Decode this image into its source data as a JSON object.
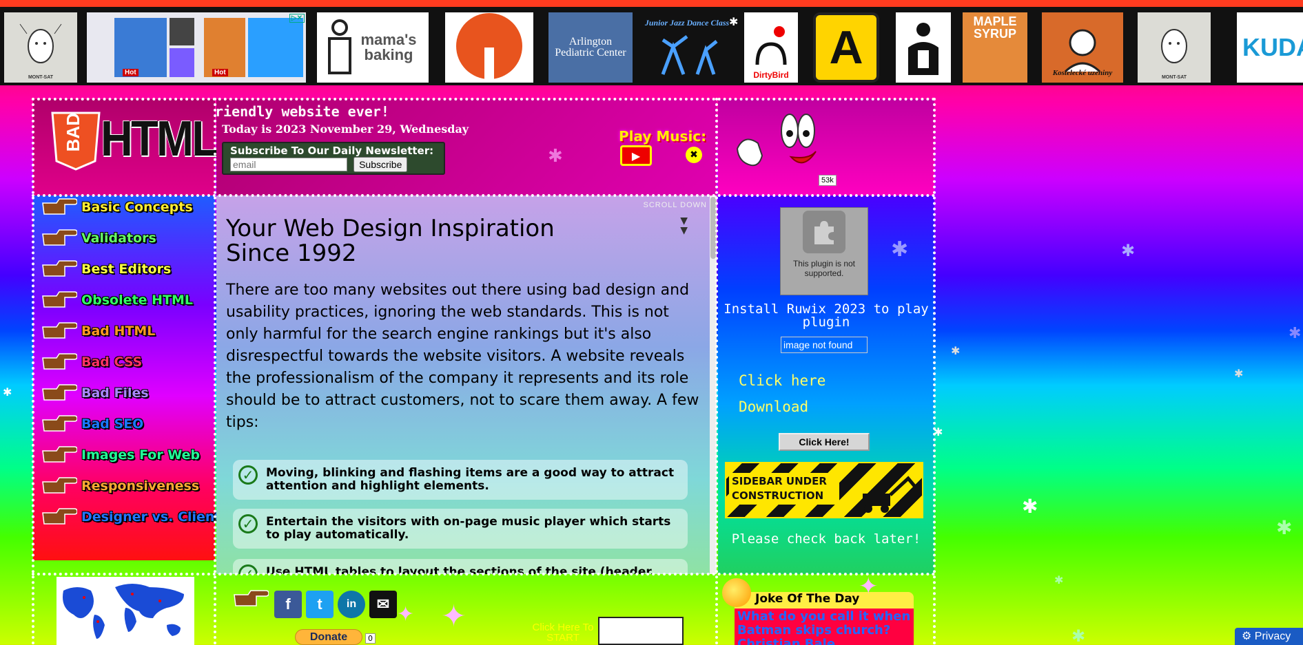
{
  "topbar": {
    "ads": [
      {
        "text": "MONT-SAT"
      },
      {
        "text": "Hot"
      },
      {
        "text": "Hot"
      },
      {
        "text": "mama's baking"
      },
      {
        "text": ""
      },
      {
        "text": "Arlington Pediatric Center"
      },
      {
        "text": "Junior Jazz Dance Class"
      },
      {
        "text": "DirtyBird"
      },
      {
        "text": "A"
      },
      {
        "text": ""
      },
      {
        "text": "MAPLE SYRUP"
      },
      {
        "text": "Kostelecké uzeniny"
      },
      {
        "text": "MONT-SAT"
      },
      {
        "text": "KUDA"
      }
    ]
  },
  "header": {
    "logo_bad": "BAD",
    "logo_html": "HTML",
    "marquee": "riendly website ever!",
    "date": "Today is 2023 November 29, Wednesday",
    "newsletter": {
      "label": "Subscribe To Our Daily Newsletter:",
      "placeholder": "email",
      "button": "Subscribe"
    },
    "music_label": "Play Music:",
    "counter": "53k"
  },
  "nav": {
    "items": [
      {
        "label": "Basic Concepts",
        "color": "#ffee33"
      },
      {
        "label": "Validators",
        "color": "#66ff66"
      },
      {
        "label": "Best Editors",
        "color": "#ffff44"
      },
      {
        "label": "Obsolete HTML",
        "color": "#33ff66"
      },
      {
        "label": "Bad HTML",
        "color": "#ff9922"
      },
      {
        "label": "Bad CSS",
        "color": "#ff3366"
      },
      {
        "label": "Bad Files",
        "color": "#aa88ff"
      },
      {
        "label": "Bad SEO",
        "color": "#1a7aff"
      },
      {
        "label": "Images For Web",
        "color": "#22ff99"
      },
      {
        "label": "Responsiveness",
        "color": "#ffaa33"
      },
      {
        "label": "Designer vs. Client",
        "color": "#2277ff"
      }
    ]
  },
  "main": {
    "scroll_down": "SCROLL DOWN",
    "title_line1": "Your Web Design Inspiration",
    "title_line2": "Since 1992",
    "intro": "There are too many websites out there using bad design and usability practices, ignoring the web standards. This is not only harmful for the search engine rankings but it's also disrespectful towards the website visitors. A website reveals the professionalism of the company it represents and its role should be to attract customers, not to scare them away. A few tips:",
    "tips": [
      "Moving, blinking and flashing items are a good way to attract attention and highlight elements.",
      "Entertain the visitors with on-page music player which starts to play automatically.",
      "Use HTML tables to layout the sections of the site (header,"
    ]
  },
  "sidebar": {
    "plugin_text": "This plugin is not supported.",
    "install_text": "Install Ruwix 2023 to play plugin",
    "broken_image": "image not found",
    "link_click": "Click here",
    "link_download": "Download",
    "click_button": "Click Here!",
    "construction": "SIDEBAR UNDER CONSTRUCTION",
    "check_back": "Please check back later!"
  },
  "footer": {
    "social": [
      "f",
      "t",
      "in",
      "✉"
    ],
    "donate": "Donate",
    "donate_count": "0",
    "click_start": "Click Here To START",
    "joke_title": "Joke Of The Day",
    "joke_text": "What do you call it when Batman skips church? Christian Bale"
  },
  "privacy": "Privacy"
}
